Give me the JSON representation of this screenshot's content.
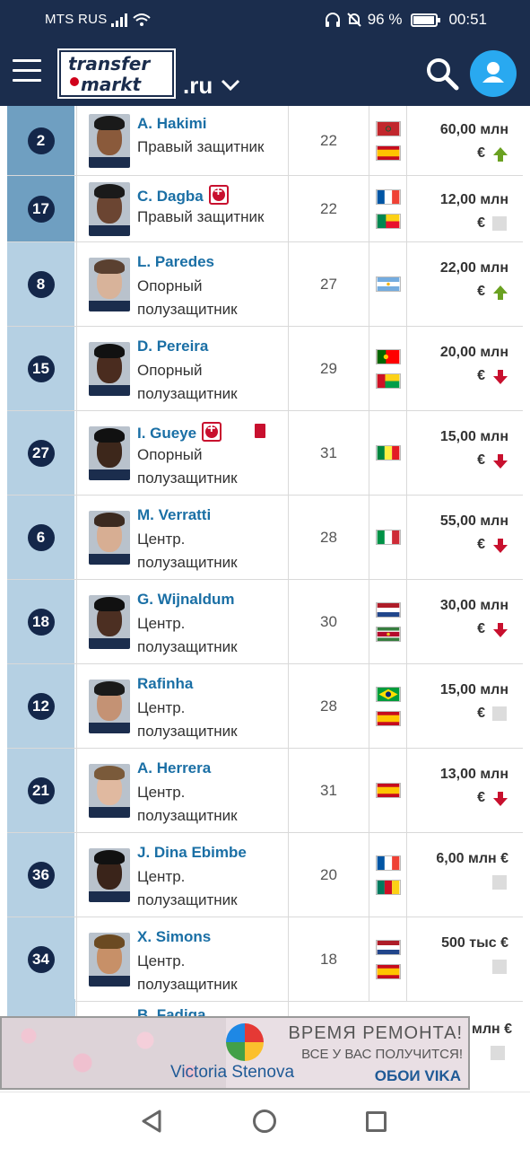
{
  "status_bar": {
    "carrier": "MTS RUS",
    "battery": "96 %",
    "time": "00:51"
  },
  "header": {
    "logo_line1": "transfer",
    "logo_line2": "markt",
    "domain": ".ru"
  },
  "players": [
    {
      "number": "2",
      "name": "A. Hakimi",
      "position": "Правый защитник",
      "age": "22",
      "value": "60,00 млн",
      "currency": "€",
      "trend": "up",
      "flags": [
        "morocco",
        "spain"
      ],
      "injury": false,
      "red_card": false,
      "num_bg": "#6f9fc1"
    },
    {
      "number": "17",
      "name": "C. Dagba",
      "position": "Правый защитник",
      "age": "22",
      "value": "12,00 млн",
      "currency": "€",
      "trend": "none",
      "flags": [
        "france",
        "benin"
      ],
      "injury": true,
      "red_card": false,
      "num_bg": "#6f9fc1"
    },
    {
      "number": "8",
      "name": "L. Paredes",
      "position": "Опорный полузащитник",
      "age": "27",
      "value": "22,00 млн",
      "currency": "€",
      "trend": "up",
      "flags": [
        "argentina"
      ],
      "injury": false,
      "red_card": false,
      "num_bg": "#b5d0e3"
    },
    {
      "number": "15",
      "name": "D. Pereira",
      "position": "Опорный полузащитник",
      "age": "29",
      "value": "20,00 млн",
      "currency": "€",
      "trend": "down",
      "flags": [
        "portugal",
        "guinea-bissau"
      ],
      "injury": false,
      "red_card": false,
      "num_bg": "#b5d0e3"
    },
    {
      "number": "27",
      "name": "I. Gueye",
      "position": "Опорный полузащитник",
      "age": "31",
      "value": "15,00 млн",
      "currency": "€",
      "trend": "down",
      "flags": [
        "senegal"
      ],
      "injury": true,
      "red_card": true,
      "num_bg": "#b5d0e3"
    },
    {
      "number": "6",
      "name": "M. Verratti",
      "position": "Центр. полузащитник",
      "age": "28",
      "value": "55,00 млн",
      "currency": "€",
      "trend": "down",
      "flags": [
        "italy"
      ],
      "injury": false,
      "red_card": false,
      "num_bg": "#b5d0e3"
    },
    {
      "number": "18",
      "name": "G. Wijnaldum",
      "position": "Центр. полузащитник",
      "age": "30",
      "value": "30,00 млн",
      "currency": "€",
      "trend": "down",
      "flags": [
        "netherlands",
        "suriname"
      ],
      "injury": false,
      "red_card": false,
      "num_bg": "#b5d0e3"
    },
    {
      "number": "12",
      "name": "Rafinha",
      "position": "Центр. полузащитник",
      "age": "28",
      "value": "15,00 млн",
      "currency": "€",
      "trend": "none",
      "flags": [
        "brazil",
        "spain"
      ],
      "injury": false,
      "red_card": false,
      "num_bg": "#b5d0e3"
    },
    {
      "number": "21",
      "name": "A. Herrera",
      "position": "Центр. полузащитник",
      "age": "31",
      "value": "13,00 млн",
      "currency": "€",
      "trend": "down",
      "flags": [
        "spain"
      ],
      "injury": false,
      "red_card": false,
      "num_bg": "#b5d0e3"
    },
    {
      "number": "36",
      "name": "J. Dina Ebimbe",
      "position": "Центр. полузащитник",
      "age": "20",
      "value": "6,00 млн €",
      "currency": "",
      "trend": "none",
      "flags": [
        "france",
        "cameroon"
      ],
      "injury": false,
      "red_card": false,
      "num_bg": "#b5d0e3"
    },
    {
      "number": "34",
      "name": "X. Simons",
      "position": "Центр. полузащитник",
      "age": "18",
      "value": "500 тыс €",
      "currency": "",
      "trend": "none",
      "flags": [
        "netherlands",
        "spain"
      ],
      "injury": false,
      "red_card": false,
      "num_bg": "#b5d0e3"
    }
  ],
  "partial_row": {
    "name": "B. Fadiga",
    "value": "млн €"
  },
  "ad": {
    "brand": "Victoria Stenova",
    "headline": "ВРЕМЯ РЕМОНТА!",
    "subline": "ВСЕ У ВАС ПОЛУЧИТСЯ!",
    "cta": "ОБОИ VIKA"
  },
  "colors": {
    "header_bg": "#1b2d4d",
    "link": "#1a6fa5",
    "trend_up": "#6aa121",
    "trend_down": "#c8102e",
    "accent": "#29a9f0"
  }
}
